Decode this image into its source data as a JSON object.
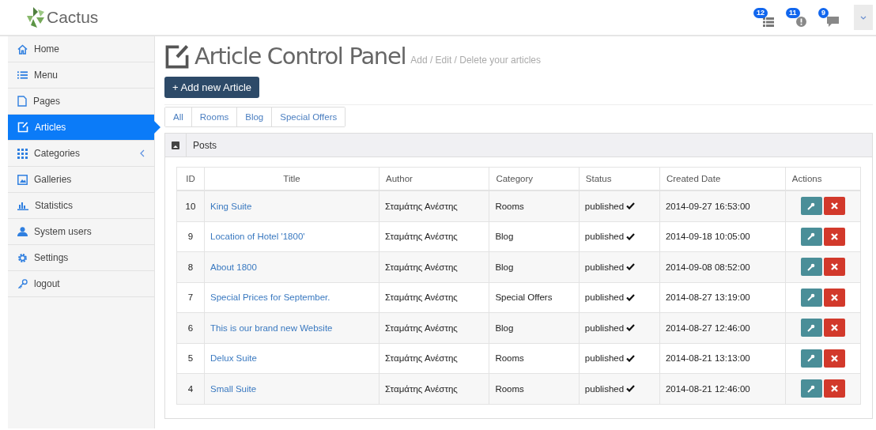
{
  "header": {
    "logo": "Cactus",
    "notifications": [
      {
        "kind": "tasks",
        "count": "12"
      },
      {
        "kind": "alerts",
        "count": "11"
      },
      {
        "kind": "messages",
        "count": "9"
      }
    ]
  },
  "sidebar": {
    "items": [
      {
        "label": "Home",
        "kind": "home",
        "selected": false,
        "submenu": false
      },
      {
        "label": "Menu",
        "kind": "list",
        "selected": false,
        "submenu": false
      },
      {
        "label": "Pages",
        "kind": "page",
        "selected": false,
        "submenu": false
      },
      {
        "label": "Articles",
        "kind": "edit",
        "selected": true,
        "submenu": false
      },
      {
        "label": "Categories",
        "kind": "grid",
        "selected": false,
        "submenu": true
      },
      {
        "label": "Galleries",
        "kind": "image",
        "selected": false,
        "submenu": false
      },
      {
        "label": "Statistics",
        "kind": "chart",
        "selected": false,
        "submenu": false
      },
      {
        "label": "System users",
        "kind": "user",
        "selected": false,
        "submenu": false
      },
      {
        "label": "Settings",
        "kind": "gear",
        "selected": false,
        "submenu": false
      },
      {
        "label": "logout",
        "kind": "key",
        "selected": false,
        "submenu": false
      }
    ]
  },
  "page": {
    "title": "Article Control Panel",
    "subtitle": "Add / Edit / Delete your articles",
    "add_button": "+ Add new Article",
    "tabs": [
      {
        "label": "All",
        "selected": false
      },
      {
        "label": "Rooms",
        "selected": false
      },
      {
        "label": "Blog",
        "selected": false
      },
      {
        "label": "Special Offers",
        "selected": false
      }
    ],
    "panel_title": "Posts",
    "table": {
      "columns": [
        "ID",
        "Title",
        "Author",
        "Category",
        "Status",
        "Created Date",
        "Actions"
      ],
      "rows": [
        {
          "id": "10",
          "title": "King Suite",
          "author": "Σταμάτης Ανέστης",
          "category": "Rooms",
          "status": "published",
          "published": true,
          "created": "2014-09-27 16:53:00"
        },
        {
          "id": "9",
          "title": "Location of Hotel '1800'",
          "author": "Σταμάτης Ανέστης",
          "category": "Blog",
          "status": "published",
          "published": true,
          "created": "2014-09-18 10:05:00"
        },
        {
          "id": "8",
          "title": "About 1800",
          "author": "Σταμάτης Ανέστης",
          "category": "Blog",
          "status": "published",
          "published": true,
          "created": "2014-09-08 08:52:00"
        },
        {
          "id": "7",
          "title": "Special Prices for September.",
          "author": "Σταμάτης Ανέστης",
          "category": "Special Offers",
          "status": "published",
          "published": true,
          "created": "2014-08-27 13:19:00"
        },
        {
          "id": "6",
          "title": "This is our brand new Website",
          "author": "Σταμάτης Ανέστης",
          "category": "Blog",
          "status": "published",
          "published": true,
          "created": "2014-08-27 12:46:00"
        },
        {
          "id": "5",
          "title": "Delux Suite",
          "author": "Σταμάτης Ανέστης",
          "category": "Rooms",
          "status": "published",
          "published": true,
          "created": "2014-08-21 13:13:00"
        },
        {
          "id": "4",
          "title": "Small Suite",
          "author": "Σταμάτης Ανέστης",
          "category": "Rooms",
          "status": "published",
          "published": true,
          "created": "2014-08-21 12:46:00"
        }
      ]
    }
  }
}
